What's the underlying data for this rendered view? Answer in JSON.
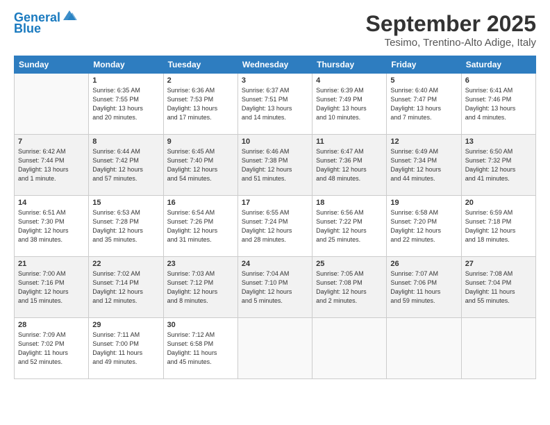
{
  "logo": {
    "line1": "General",
    "line2": "Blue"
  },
  "title": "September 2025",
  "location": "Tesimo, Trentino-Alto Adige, Italy",
  "days_header": [
    "Sunday",
    "Monday",
    "Tuesday",
    "Wednesday",
    "Thursday",
    "Friday",
    "Saturday"
  ],
  "weeks": [
    [
      {
        "num": "",
        "info": ""
      },
      {
        "num": "1",
        "info": "Sunrise: 6:35 AM\nSunset: 7:55 PM\nDaylight: 13 hours\nand 20 minutes."
      },
      {
        "num": "2",
        "info": "Sunrise: 6:36 AM\nSunset: 7:53 PM\nDaylight: 13 hours\nand 17 minutes."
      },
      {
        "num": "3",
        "info": "Sunrise: 6:37 AM\nSunset: 7:51 PM\nDaylight: 13 hours\nand 14 minutes."
      },
      {
        "num": "4",
        "info": "Sunrise: 6:39 AM\nSunset: 7:49 PM\nDaylight: 13 hours\nand 10 minutes."
      },
      {
        "num": "5",
        "info": "Sunrise: 6:40 AM\nSunset: 7:47 PM\nDaylight: 13 hours\nand 7 minutes."
      },
      {
        "num": "6",
        "info": "Sunrise: 6:41 AM\nSunset: 7:46 PM\nDaylight: 13 hours\nand 4 minutes."
      }
    ],
    [
      {
        "num": "7",
        "info": "Sunrise: 6:42 AM\nSunset: 7:44 PM\nDaylight: 13 hours\nand 1 minute."
      },
      {
        "num": "8",
        "info": "Sunrise: 6:44 AM\nSunset: 7:42 PM\nDaylight: 12 hours\nand 57 minutes."
      },
      {
        "num": "9",
        "info": "Sunrise: 6:45 AM\nSunset: 7:40 PM\nDaylight: 12 hours\nand 54 minutes."
      },
      {
        "num": "10",
        "info": "Sunrise: 6:46 AM\nSunset: 7:38 PM\nDaylight: 12 hours\nand 51 minutes."
      },
      {
        "num": "11",
        "info": "Sunrise: 6:47 AM\nSunset: 7:36 PM\nDaylight: 12 hours\nand 48 minutes."
      },
      {
        "num": "12",
        "info": "Sunrise: 6:49 AM\nSunset: 7:34 PM\nDaylight: 12 hours\nand 44 minutes."
      },
      {
        "num": "13",
        "info": "Sunrise: 6:50 AM\nSunset: 7:32 PM\nDaylight: 12 hours\nand 41 minutes."
      }
    ],
    [
      {
        "num": "14",
        "info": "Sunrise: 6:51 AM\nSunset: 7:30 PM\nDaylight: 12 hours\nand 38 minutes."
      },
      {
        "num": "15",
        "info": "Sunrise: 6:53 AM\nSunset: 7:28 PM\nDaylight: 12 hours\nand 35 minutes."
      },
      {
        "num": "16",
        "info": "Sunrise: 6:54 AM\nSunset: 7:26 PM\nDaylight: 12 hours\nand 31 minutes."
      },
      {
        "num": "17",
        "info": "Sunrise: 6:55 AM\nSunset: 7:24 PM\nDaylight: 12 hours\nand 28 minutes."
      },
      {
        "num": "18",
        "info": "Sunrise: 6:56 AM\nSunset: 7:22 PM\nDaylight: 12 hours\nand 25 minutes."
      },
      {
        "num": "19",
        "info": "Sunrise: 6:58 AM\nSunset: 7:20 PM\nDaylight: 12 hours\nand 22 minutes."
      },
      {
        "num": "20",
        "info": "Sunrise: 6:59 AM\nSunset: 7:18 PM\nDaylight: 12 hours\nand 18 minutes."
      }
    ],
    [
      {
        "num": "21",
        "info": "Sunrise: 7:00 AM\nSunset: 7:16 PM\nDaylight: 12 hours\nand 15 minutes."
      },
      {
        "num": "22",
        "info": "Sunrise: 7:02 AM\nSunset: 7:14 PM\nDaylight: 12 hours\nand 12 minutes."
      },
      {
        "num": "23",
        "info": "Sunrise: 7:03 AM\nSunset: 7:12 PM\nDaylight: 12 hours\nand 8 minutes."
      },
      {
        "num": "24",
        "info": "Sunrise: 7:04 AM\nSunset: 7:10 PM\nDaylight: 12 hours\nand 5 minutes."
      },
      {
        "num": "25",
        "info": "Sunrise: 7:05 AM\nSunset: 7:08 PM\nDaylight: 12 hours\nand 2 minutes."
      },
      {
        "num": "26",
        "info": "Sunrise: 7:07 AM\nSunset: 7:06 PM\nDaylight: 11 hours\nand 59 minutes."
      },
      {
        "num": "27",
        "info": "Sunrise: 7:08 AM\nSunset: 7:04 PM\nDaylight: 11 hours\nand 55 minutes."
      }
    ],
    [
      {
        "num": "28",
        "info": "Sunrise: 7:09 AM\nSunset: 7:02 PM\nDaylight: 11 hours\nand 52 minutes."
      },
      {
        "num": "29",
        "info": "Sunrise: 7:11 AM\nSunset: 7:00 PM\nDaylight: 11 hours\nand 49 minutes."
      },
      {
        "num": "30",
        "info": "Sunrise: 7:12 AM\nSunset: 6:58 PM\nDaylight: 11 hours\nand 45 minutes."
      },
      {
        "num": "",
        "info": ""
      },
      {
        "num": "",
        "info": ""
      },
      {
        "num": "",
        "info": ""
      },
      {
        "num": "",
        "info": ""
      }
    ]
  ]
}
